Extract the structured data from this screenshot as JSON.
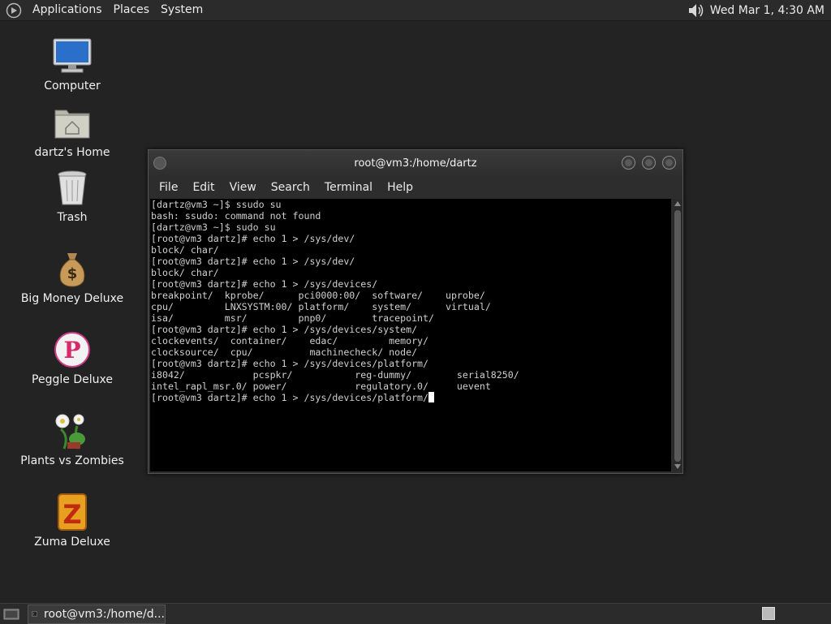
{
  "top_panel": {
    "menus": [
      "Applications",
      "Places",
      "System"
    ],
    "clock": "Wed Mar  1,  4:30 AM"
  },
  "desktop": {
    "icons": [
      {
        "label": "Computer",
        "icon": "computer-icon"
      },
      {
        "label": "dartz's Home",
        "icon": "home-folder-icon"
      },
      {
        "label": "Trash",
        "icon": "trash-icon"
      },
      {
        "label": "Big Money Deluxe",
        "icon": "money-bag-icon"
      },
      {
        "label": "Peggle Deluxe",
        "icon": "peggle-icon"
      },
      {
        "label": "Plants vs Zombies",
        "icon": "plants-icon"
      },
      {
        "label": "Zuma Deluxe",
        "icon": "zuma-icon"
      }
    ]
  },
  "terminal": {
    "title": "root@vm3:/home/dartz",
    "menus": [
      "File",
      "Edit",
      "View",
      "Search",
      "Terminal",
      "Help"
    ],
    "lines": [
      "[dartz@vm3 ~]$ ssudo su",
      "bash: ssudo: command not found",
      "[dartz@vm3 ~]$ sudo su",
      "[root@vm3 dartz]# echo 1 > /sys/dev/",
      "block/ char/",
      "[root@vm3 dartz]# echo 1 > /sys/dev/",
      "block/ char/",
      "[root@vm3 dartz]# echo 1 > /sys/devices/",
      "breakpoint/  kprobe/      pci0000:00/  software/    uprobe/",
      "cpu/         LNXSYSTM:00/ platform/    system/      virtual/",
      "isa/         msr/         pnp0/        tracepoint/",
      "[root@vm3 dartz]# echo 1 > /sys/devices/system/",
      "clockevents/  container/    edac/         memory/",
      "clocksource/  cpu/          machinecheck/ node/",
      "[root@vm3 dartz]# echo 1 > /sys/devices/platform/",
      "i8042/            pcspkr/           reg-dummy/        serial8250/",
      "intel_rapl_msr.0/ power/            regulatory.0/     uevent"
    ],
    "prompt_line": "[root@vm3 dartz]# echo 1 > /sys/devices/platform/"
  },
  "taskbar": {
    "task_label": "root@vm3:/home/d..."
  }
}
